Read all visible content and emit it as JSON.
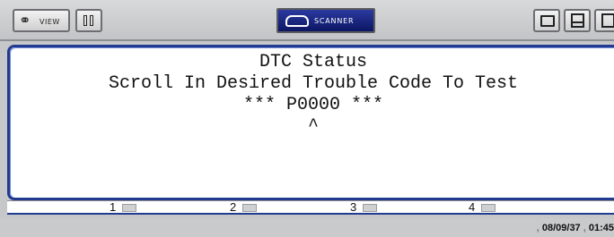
{
  "toolbar": {
    "view_label": "VIEW",
    "scanner_label": "SCANNER",
    "icons": [
      "binoculars-icon",
      "pause-icon",
      "car-icon",
      "window-icon",
      "printer-icon"
    ]
  },
  "display": {
    "lines": [
      "DTC Status",
      "Scroll In Desired Trouble Code To Test",
      "*** P0000 ***",
      "^"
    ]
  },
  "softkeys": [
    {
      "number": "1"
    },
    {
      "number": "2"
    },
    {
      "number": "3"
    },
    {
      "number": "4"
    }
  ],
  "status": {
    "date": "08/09/37",
    "time": "01:45"
  },
  "colors": {
    "accent": "#223a8f",
    "scanner_button": "#1a2a85",
    "background": "#c9cacc"
  }
}
